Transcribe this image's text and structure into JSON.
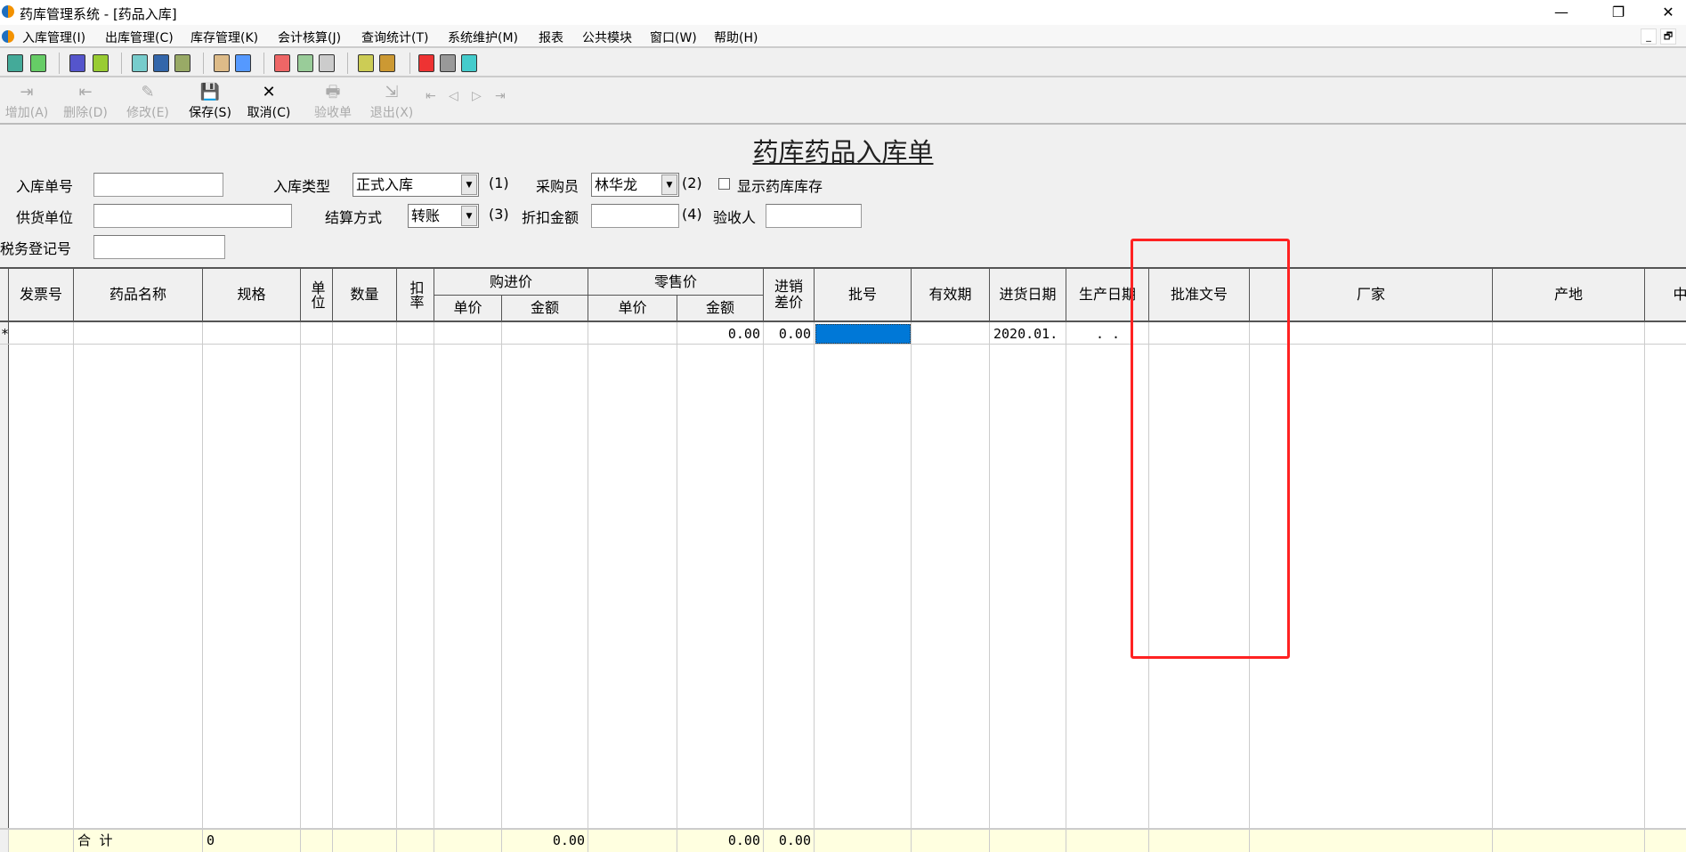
{
  "window": {
    "title": "药库管理系统 - [药品入库]",
    "min": "—",
    "restore": "❐",
    "close": "✕"
  },
  "menu": [
    "入库管理(I)",
    "出库管理(C)",
    "库存管理(K)",
    "会计核算(J)",
    "查询统计(T)",
    "系统维护(M)",
    "报表",
    "公共模块",
    "窗口(W)",
    "帮助(H)"
  ],
  "mdi": {
    "min": "_",
    "restore": "🗗"
  },
  "toolbar2": [
    {
      "label": "增加(A)",
      "icon": "add-icon",
      "glyph": "⇥",
      "enabled": false
    },
    {
      "label": "删除(D)",
      "icon": "delete-icon",
      "glyph": "⇤",
      "enabled": false
    },
    {
      "label": "修改(E)",
      "icon": "edit-icon",
      "glyph": "✎",
      "enabled": false
    },
    {
      "label": "保存(S)",
      "icon": "save-icon",
      "glyph": "💾",
      "enabled": true
    },
    {
      "label": "取消(C)",
      "icon": "cancel-icon",
      "glyph": "✕",
      "enabled": true
    },
    {
      "label": "验收单",
      "icon": "print-icon",
      "glyph": "🖶",
      "enabled": false
    },
    {
      "label": "退出(X)",
      "icon": "exit-icon",
      "glyph": "⇲",
      "enabled": false
    }
  ],
  "nav": [
    "⇤",
    "◁",
    "▷",
    "⇥"
  ],
  "form": {
    "heading": "药库药品入库单",
    "receipt_no_label": "入库单号",
    "receipt_no": "",
    "type_label": "入库类型",
    "type_value": "正式入库",
    "hint1": "(1)",
    "buyer_label": "采购员",
    "buyer_value": "林华龙",
    "hint2": "(2)",
    "show_stock_label": "显示药库库存",
    "show_stock": false,
    "supplier_label": "供货单位",
    "supplier": "",
    "settle_label": "结算方式",
    "settle_value": "转账",
    "hint3": "(3)",
    "discount_label": "折扣金额",
    "discount": "",
    "hint4": "(4)",
    "inspector_label": "验收人",
    "inspector": "",
    "tax_label": "税务登记号",
    "tax": ""
  },
  "grid": {
    "columns": [
      "发票号",
      "药品名称",
      "规格",
      "单位",
      "数量",
      "扣率",
      "单价",
      "金额",
      "单价",
      "金额",
      "进销差价",
      "批号",
      "有效期",
      "进货日期",
      "生产日期",
      "批准文号",
      "",
      "厂家",
      "产地",
      "中标价"
    ],
    "groups": [
      {
        "label": "购进价"
      },
      {
        "label": "零售价"
      }
    ],
    "new_row": {
      "marker": "*",
      "retail_amount": "0.00",
      "diff": "0.00",
      "date_in": "2020.01.",
      "date_made": ".  ."
    },
    "total": {
      "label": "合  计",
      "spec": "0",
      "buy_amount": "0.00",
      "retail_amount": "0.00",
      "diff": "0.00"
    },
    "colors": {
      "selected": "#0078d7",
      "total_bg": "#ffffe0",
      "annotation": "#ff2222"
    }
  }
}
